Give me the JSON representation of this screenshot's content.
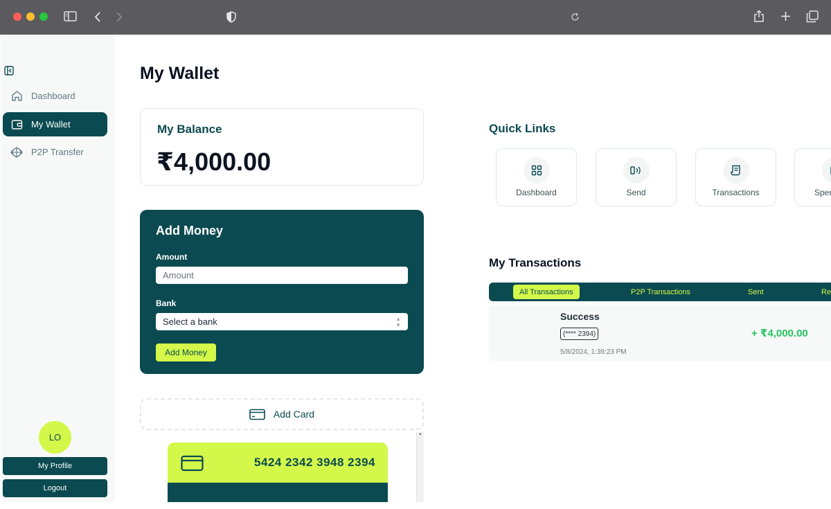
{
  "sidebar": {
    "items": [
      {
        "label": "Dashboard",
        "icon": "home-icon"
      },
      {
        "label": "My Wallet",
        "icon": "wallet-icon"
      },
      {
        "label": "P2P Transfer",
        "icon": "transfer-icon"
      }
    ],
    "avatar_initials": "LO",
    "profile_label": "My Profile",
    "logout_label": "Logout"
  },
  "main": {
    "title": "My Wallet",
    "balance": {
      "label": "My Balance",
      "amount": "₹4,000.00"
    },
    "add_money": {
      "title": "Add Money",
      "amount_label": "Amount",
      "amount_placeholder": "Amount",
      "bank_label": "Bank",
      "bank_selected": "Select a bank",
      "submit_label": "Add Money"
    },
    "add_card_label": "Add Card",
    "card": {
      "number": "5424 2342 3948 2394"
    }
  },
  "quick_links": {
    "title": "Quick Links",
    "items": [
      {
        "label": "Dashboard",
        "icon": "grid-icon"
      },
      {
        "label": "Send",
        "icon": "contactless-icon"
      },
      {
        "label": "Transactions",
        "icon": "receipt-icon"
      },
      {
        "label": "Spen",
        "icon": "spending-icon"
      }
    ]
  },
  "transactions": {
    "title": "My Transactions",
    "tabs": [
      "All Transactions",
      "P2P Transactions",
      "Sent",
      "Re"
    ],
    "rows": [
      {
        "status": "Success",
        "card": "(**** 2394)",
        "date": "5/8/2024, 1:39:23 PM",
        "amount": "+ ₹4,000.00"
      }
    ]
  },
  "colors": {
    "brand_dark": "#0a4a50",
    "brand_accent": "#d3f84a",
    "success": "#22c55e"
  }
}
